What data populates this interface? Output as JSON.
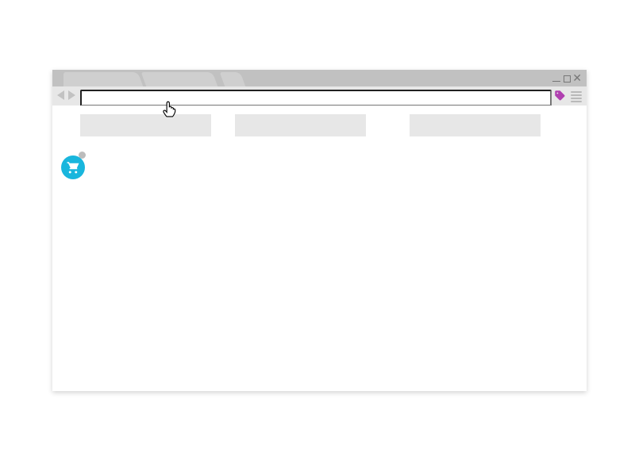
{
  "addressbar": {
    "value": "",
    "placeholder": ""
  },
  "tabs": [
    "",
    "",
    ""
  ],
  "content_blocks": [
    "",
    "",
    ""
  ],
  "cart": {
    "count": null
  },
  "colors": {
    "tabstrip": "#c1c1c1",
    "chrome": "#e7e7e7",
    "accent": "#19b6dd",
    "ext": "#b03fb0"
  }
}
